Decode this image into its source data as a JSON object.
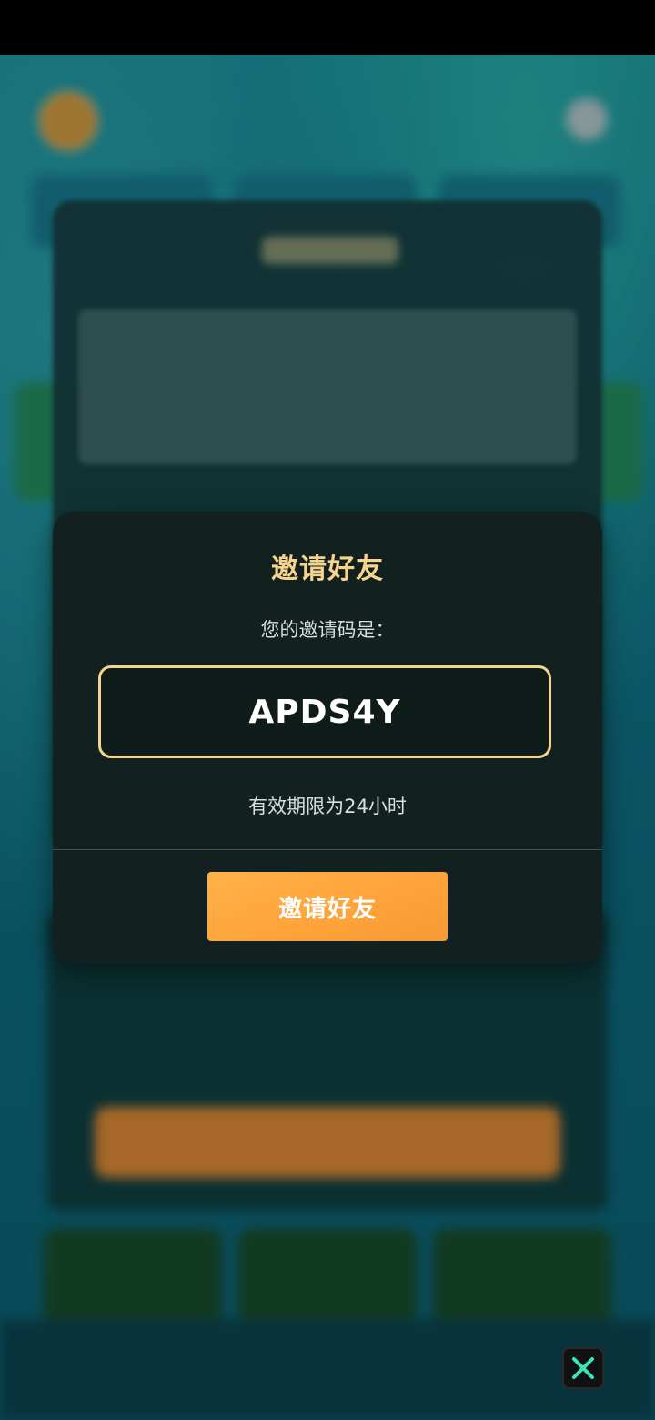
{
  "modal": {
    "title": "邀请好友",
    "code_label": "您的邀请码是：",
    "invite_code": "APDS4Y",
    "validity_note": "有效期限为24小时",
    "invite_button_label": "邀请好友"
  },
  "colors": {
    "modal_bg": "#12211f",
    "title": "#f7d48b",
    "code_border": "#f3d58e",
    "button": "#ffa43a",
    "close_icon": "#3ce3b6"
  },
  "overlay": {
    "close_icon": "close-icon"
  }
}
